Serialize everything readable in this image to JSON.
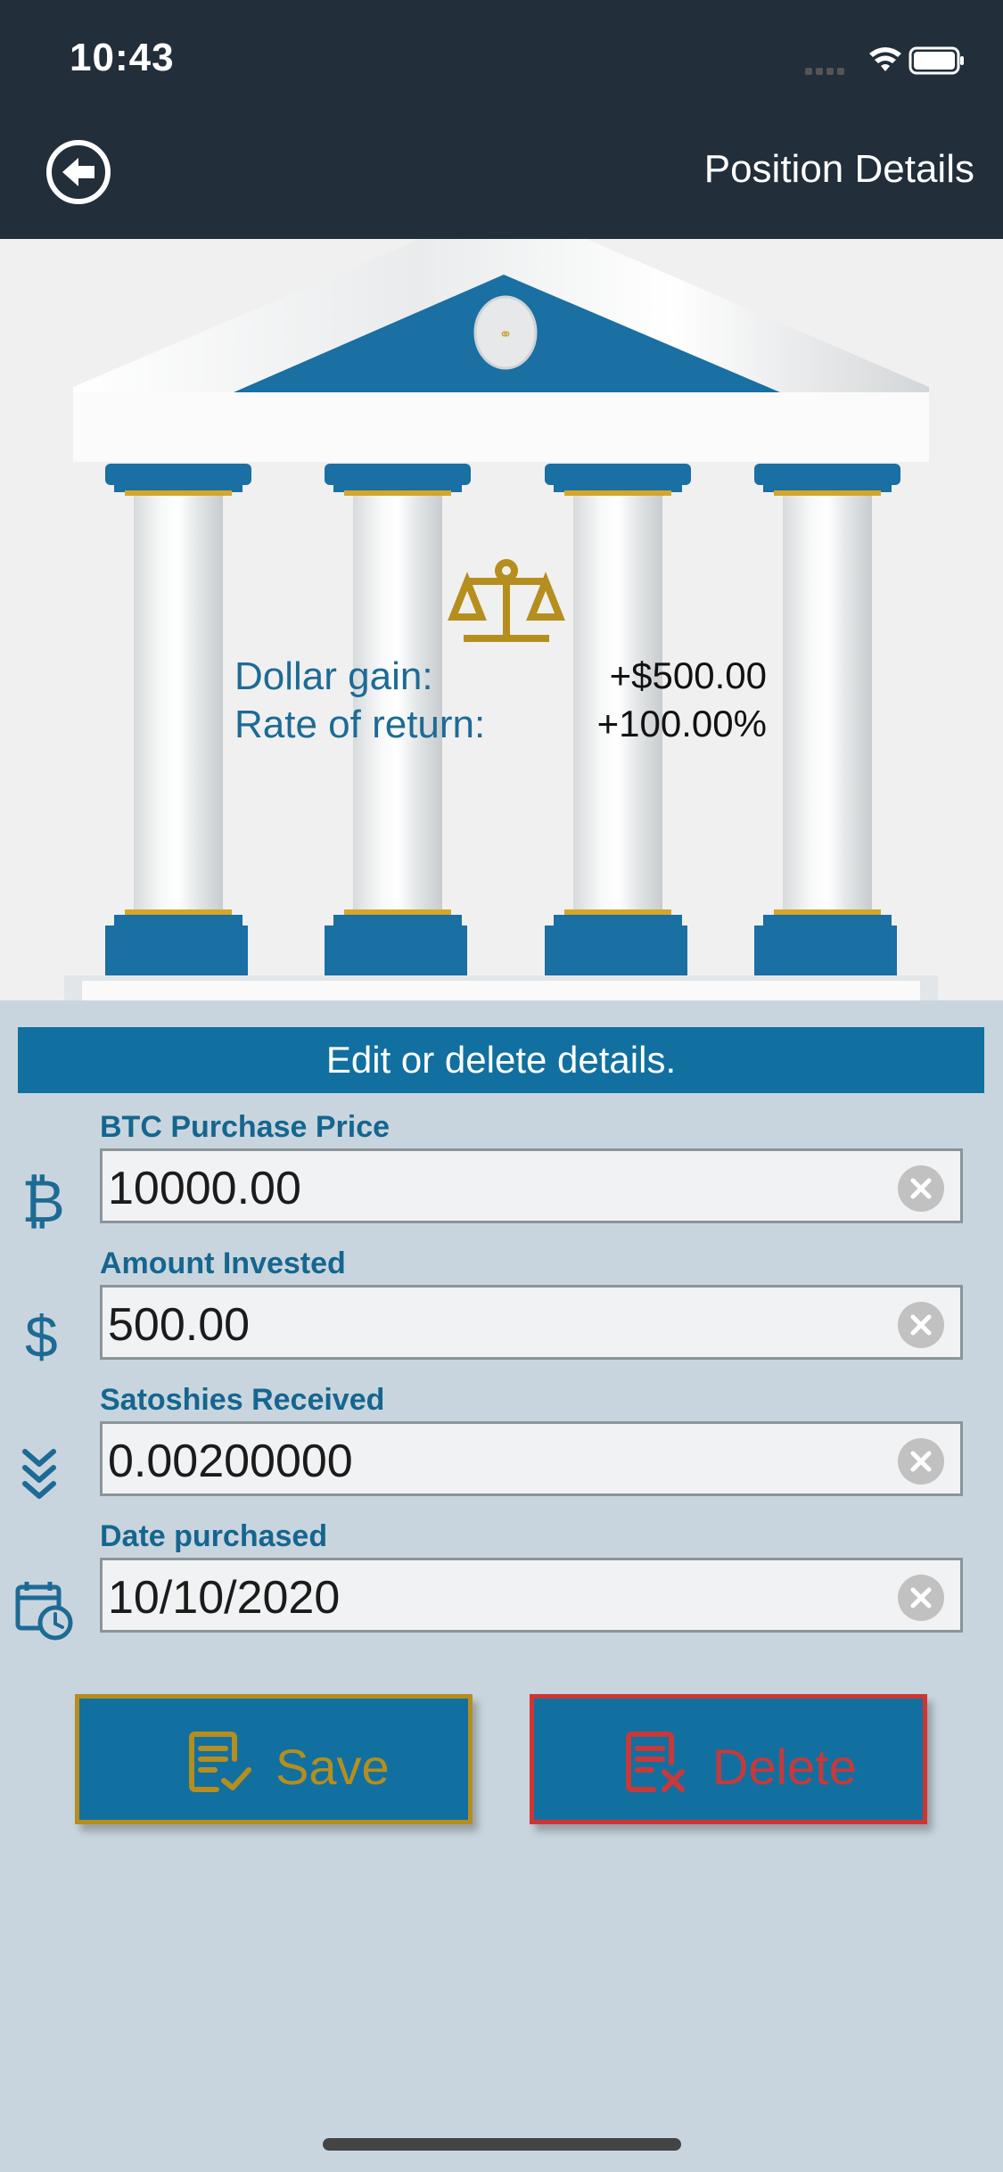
{
  "status_bar": {
    "time": "10:43"
  },
  "nav": {
    "title": "Position Details",
    "back_icon": "back-arrow-circle-icon"
  },
  "summary": {
    "dollar_gain_label": "Dollar gain:",
    "dollar_gain_value": "+$500.00",
    "rate_of_return_label": "Rate of return:",
    "rate_of_return_value": "+100.00%"
  },
  "banner": {
    "text": "Edit or delete details."
  },
  "fields": {
    "btc_price": {
      "label": "BTC Purchase Price",
      "value": "10000.00",
      "icon": "bitcoin-icon"
    },
    "amount_invested": {
      "label": "Amount Invested",
      "value": "500.00",
      "icon": "dollar-icon"
    },
    "satoshies": {
      "label": "Satoshies Received",
      "value": "0.00200000",
      "icon": "chevrons-down-icon"
    },
    "date": {
      "label": "Date purchased",
      "value": "10/10/2020",
      "icon": "calendar-clock-icon"
    }
  },
  "buttons": {
    "save": "Save",
    "delete": "Delete"
  },
  "colors": {
    "nav_bg": "#222e39",
    "accent_blue": "#1170a0",
    "gold": "#b58e1e",
    "danger": "#d03434",
    "background": "#c9d5de"
  }
}
